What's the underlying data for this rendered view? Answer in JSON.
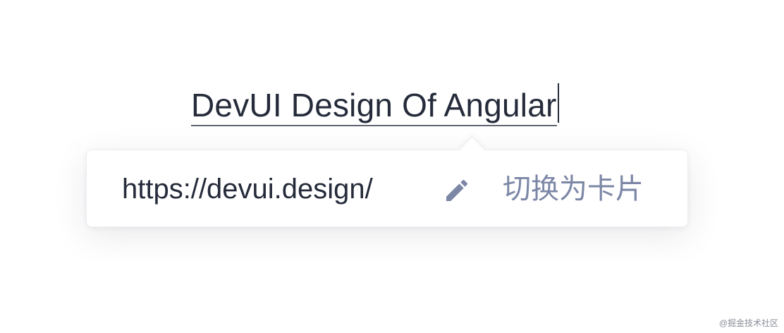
{
  "editor": {
    "link_text": "DevUI Design Of Angular"
  },
  "popover": {
    "url": "https://devui.design/",
    "edit_icon": "pencil-icon",
    "switch_label": "切换为卡片"
  },
  "watermark": {
    "text": "@掘金技术社区"
  },
  "colors": {
    "text": "#252b3a",
    "link_underline": "#5e6470",
    "icon": "#7c87a6",
    "secondary_text": "#7c87a6"
  }
}
